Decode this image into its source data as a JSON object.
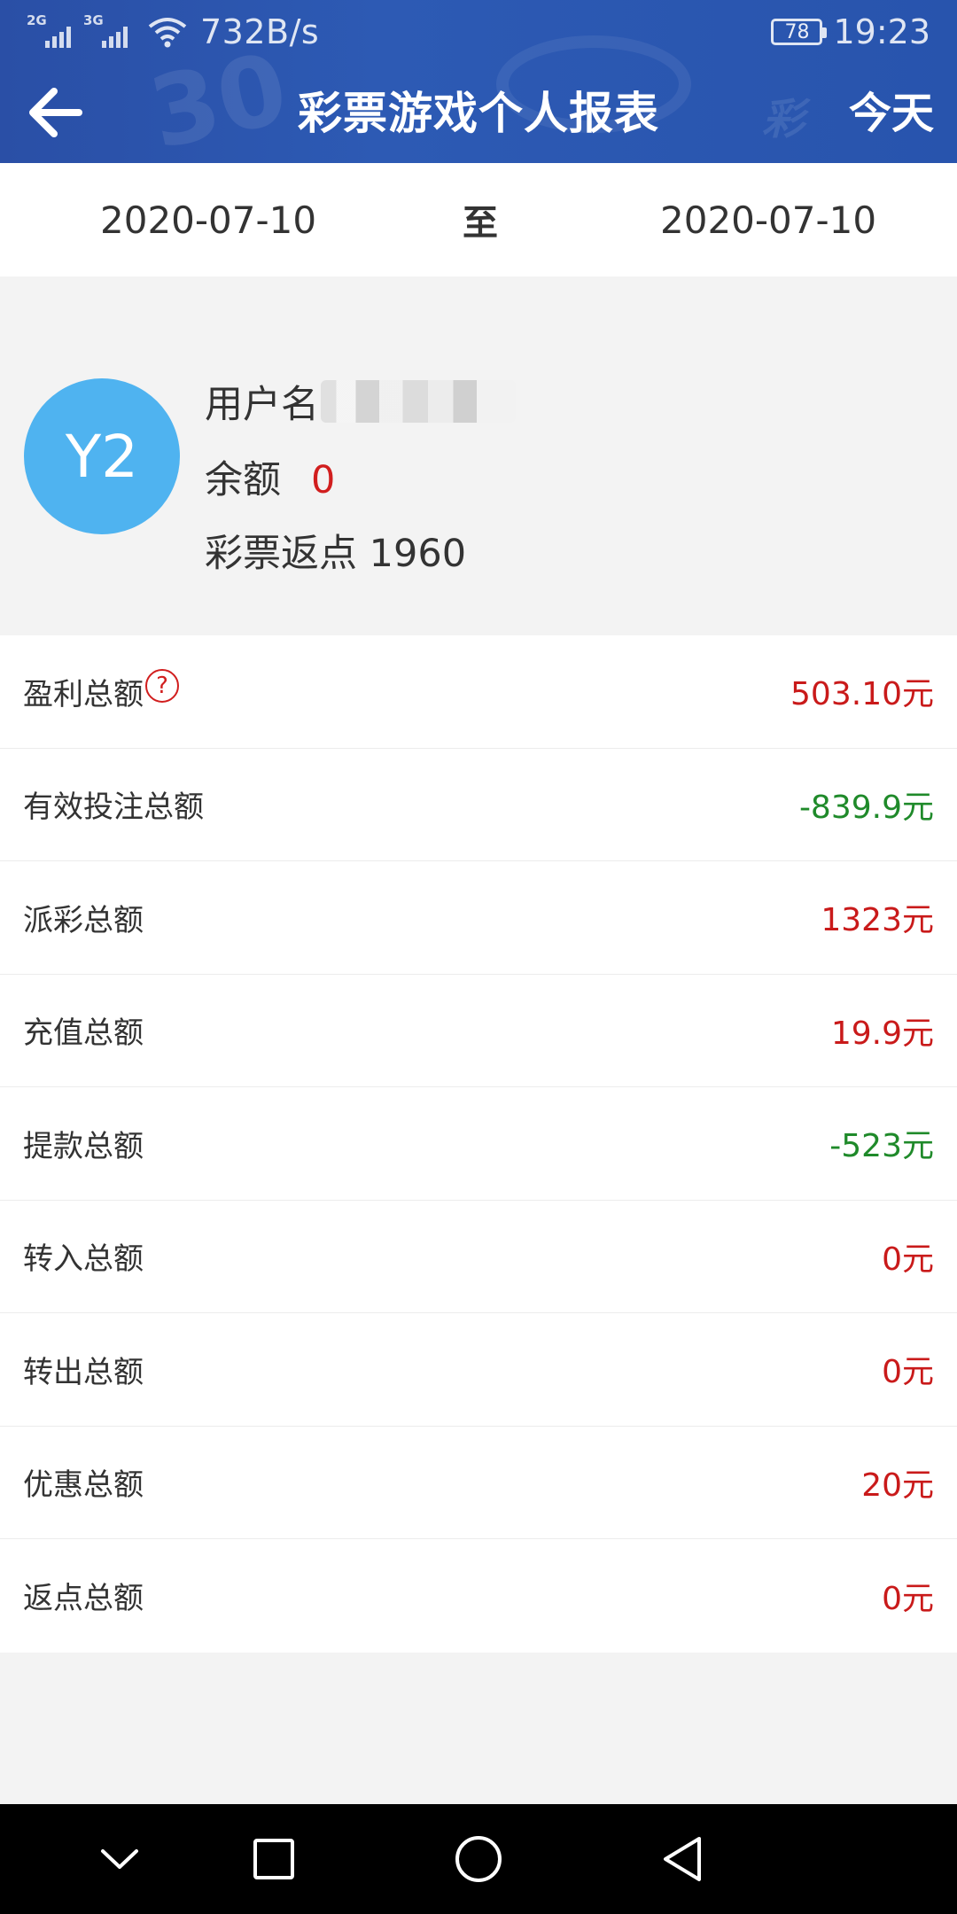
{
  "status_bar": {
    "net1": "2G",
    "net2": "3G",
    "speed": "732B/s",
    "battery": "78",
    "time": "19:23"
  },
  "header": {
    "title": "彩票游戏个人报表",
    "today_label": "今天"
  },
  "date_range": {
    "start": "2020-07-10",
    "separator": "至",
    "end": "2020-07-10"
  },
  "profile": {
    "avatar_text": "Y2",
    "username_label": "用户名",
    "balance_label": "余额",
    "balance_value": "0",
    "rebate_text": "彩票返点 1960"
  },
  "stats": [
    {
      "label": "盈利总额",
      "value": "503.10元",
      "tone": "pos",
      "help": true
    },
    {
      "label": "有效投注总额",
      "value": "-839.9元",
      "tone": "neg"
    },
    {
      "label": "派彩总额",
      "value": "1323元",
      "tone": "pos"
    },
    {
      "label": "充值总额",
      "value": "19.9元",
      "tone": "pos"
    },
    {
      "label": "提款总额",
      "value": "-523元",
      "tone": "neg"
    },
    {
      "label": "转入总额",
      "value": "0元",
      "tone": "pos"
    },
    {
      "label": "转出总额",
      "value": "0元",
      "tone": "pos"
    },
    {
      "label": "优惠总额",
      "value": "20元",
      "tone": "pos"
    },
    {
      "label": "返点总额",
      "value": "0元",
      "tone": "pos"
    }
  ],
  "help_icon_glyph": "?",
  "colors": {
    "header_bg": "#2a55ad",
    "positive": "#c91a1a",
    "negative": "#1f8a2a",
    "avatar_bg": "#4fb3f0"
  }
}
